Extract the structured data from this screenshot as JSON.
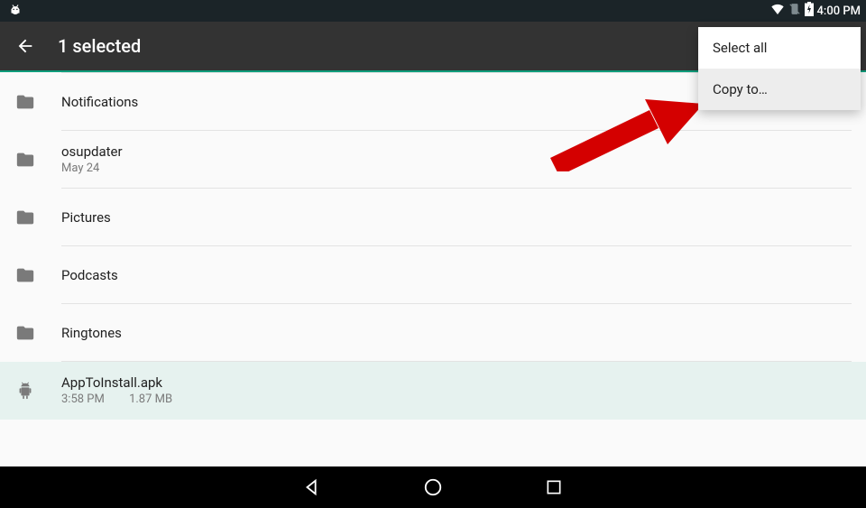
{
  "status": {
    "time": "4:00 PM"
  },
  "appbar": {
    "title": "1 selected"
  },
  "files": [
    {
      "name": "Notifications",
      "kind": "folder",
      "time": "",
      "size": ""
    },
    {
      "name": "osupdater",
      "kind": "folder",
      "time": "May 24",
      "size": ""
    },
    {
      "name": "Pictures",
      "kind": "folder",
      "time": "",
      "size": ""
    },
    {
      "name": "Podcasts",
      "kind": "folder",
      "time": "",
      "size": ""
    },
    {
      "name": "Ringtones",
      "kind": "folder",
      "time": "",
      "size": ""
    },
    {
      "name": "AppToInstall.apk",
      "kind": "apk",
      "time": "3:58 PM",
      "size": "1.87 MB",
      "selected": true
    }
  ],
  "menu": {
    "select_all": "Select all",
    "copy_to": "Copy to…"
  }
}
